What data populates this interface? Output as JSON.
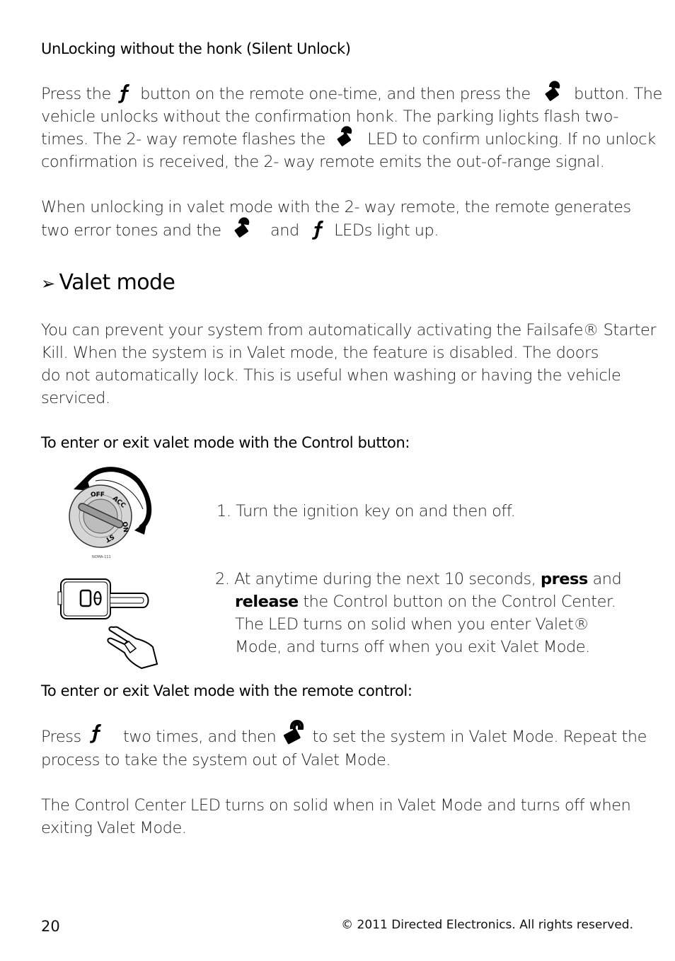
{
  "section_silent_unlock": {
    "title": "UnLocking without the honk (Silent Unlock)",
    "para1": {
      "l1a": "Press the",
      "l1b": "button on the remote one-time, and then press the",
      "l1c": "button. The",
      "l2": "vehicle unlocks without the confirmation honk. The parking lights flash two-",
      "l3a": "times. The 2- way remote flashes the",
      "l3b": "LED to confirm unlocking. If no unlock",
      "l4": "confirmation is received, the 2- way remote emits the out-of-range signal."
    },
    "para2": {
      "l1": "When unlocking in valet mode with the 2- way remote, the remote generates",
      "l2a": "two error tones and the",
      "l2b": "and",
      "l2c": "LEDs light up."
    }
  },
  "section_valet": {
    "bullet": "➢",
    "title": "Valet mode",
    "intro": [
      "You can prevent your system from automatically activating the Failsafe® Starter",
      "Kill. When the system is in Valet mode, the feature is disabled. The doors",
      "do not automatically lock. This is useful when washing or having the vehicle",
      "serviced."
    ],
    "control_button_heading": "To enter or exit valet mode with the Control button:",
    "ignition_labels": {
      "off": "OFF",
      "acc": "ACC",
      "on": "ON",
      "st": "ST",
      "caption": "NOMA-111"
    },
    "step1": "1. Turn the ignition key on and then off.",
    "step2": {
      "l1a": "2. At anytime during the next 10 seconds,",
      "l1b": "press",
      "l1c": "and",
      "l2a": "release",
      "l2b": "the Control button on the Control Center.",
      "l3": "The LED turns on solid when you enter Valet®",
      "l4": "Mode, and turns off when you exit Valet Mode."
    },
    "remote_heading": "To enter or exit Valet mode with the remote control:",
    "remote_para": {
      "l1a": "Press",
      "l1b": "two times, and then",
      "l1c": "to set the system in Valet Mode.   Repeat the",
      "l2": "process to take the system out of Valet Mode."
    },
    "led_para": [
      "The Control Center LED turns on solid when in Valet Mode and turns off when",
      "exiting Valet Mode."
    ]
  },
  "icons": {
    "function": "function-f-icon",
    "unlock": "unlock-padlock-icon"
  },
  "footer": {
    "page_number": "20",
    "copyright": "© 2011 Directed Electronics. All rights reserved."
  }
}
